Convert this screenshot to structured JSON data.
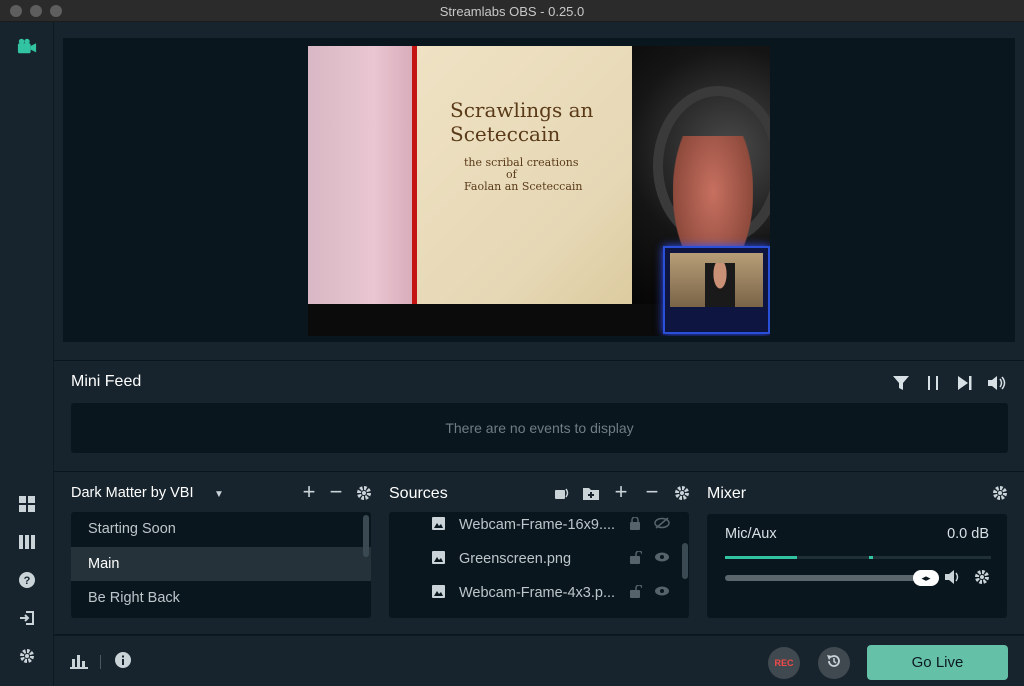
{
  "window": {
    "title": "Streamlabs OBS - 0.25.0"
  },
  "sidebar": {
    "top_icon": "studio-camera-icon",
    "bottom_icons": [
      "dashboard-layout-icon",
      "columns-icon",
      "help-icon",
      "login-icon",
      "settings-gear-icon"
    ]
  },
  "preview": {
    "book_title_line1": "Scrawlings an",
    "book_title_line2": "Sceteccain",
    "book_subtitle_line1": "the scribal creations",
    "book_subtitle_line2": "of",
    "book_subtitle_line3": "Faolan an Sceteccain"
  },
  "minifeed": {
    "title": "Mini Feed",
    "empty_text": "There are no events to display",
    "icons": [
      "filter-icon",
      "pause-icon",
      "skip-icon",
      "volume-icon"
    ]
  },
  "scenes": {
    "collection_name": "Dark Matter by VBI",
    "items": [
      {
        "label": "Starting Soon"
      },
      {
        "label": "Main"
      },
      {
        "label": "Be Right Back"
      }
    ]
  },
  "sources": {
    "title": "Sources",
    "items": [
      {
        "label": "Webcam-Frame-16x9...."
      },
      {
        "label": "Greenscreen.png"
      },
      {
        "label": "Webcam-Frame-4x3.p..."
      }
    ]
  },
  "mixer": {
    "title": "Mixer",
    "channel_name": "Mic/Aux",
    "channel_db": "0.0 dB",
    "meter_level": 0.27,
    "volume_level": 0.95
  },
  "footer": {
    "rec_label": "REC",
    "go_live_label": "Go Live"
  },
  "colors": {
    "accent": "#80f5d2",
    "background": "#09161d",
    "panel": "#17242d",
    "meter": "#31c3a2",
    "rec": "#f04a4a"
  }
}
